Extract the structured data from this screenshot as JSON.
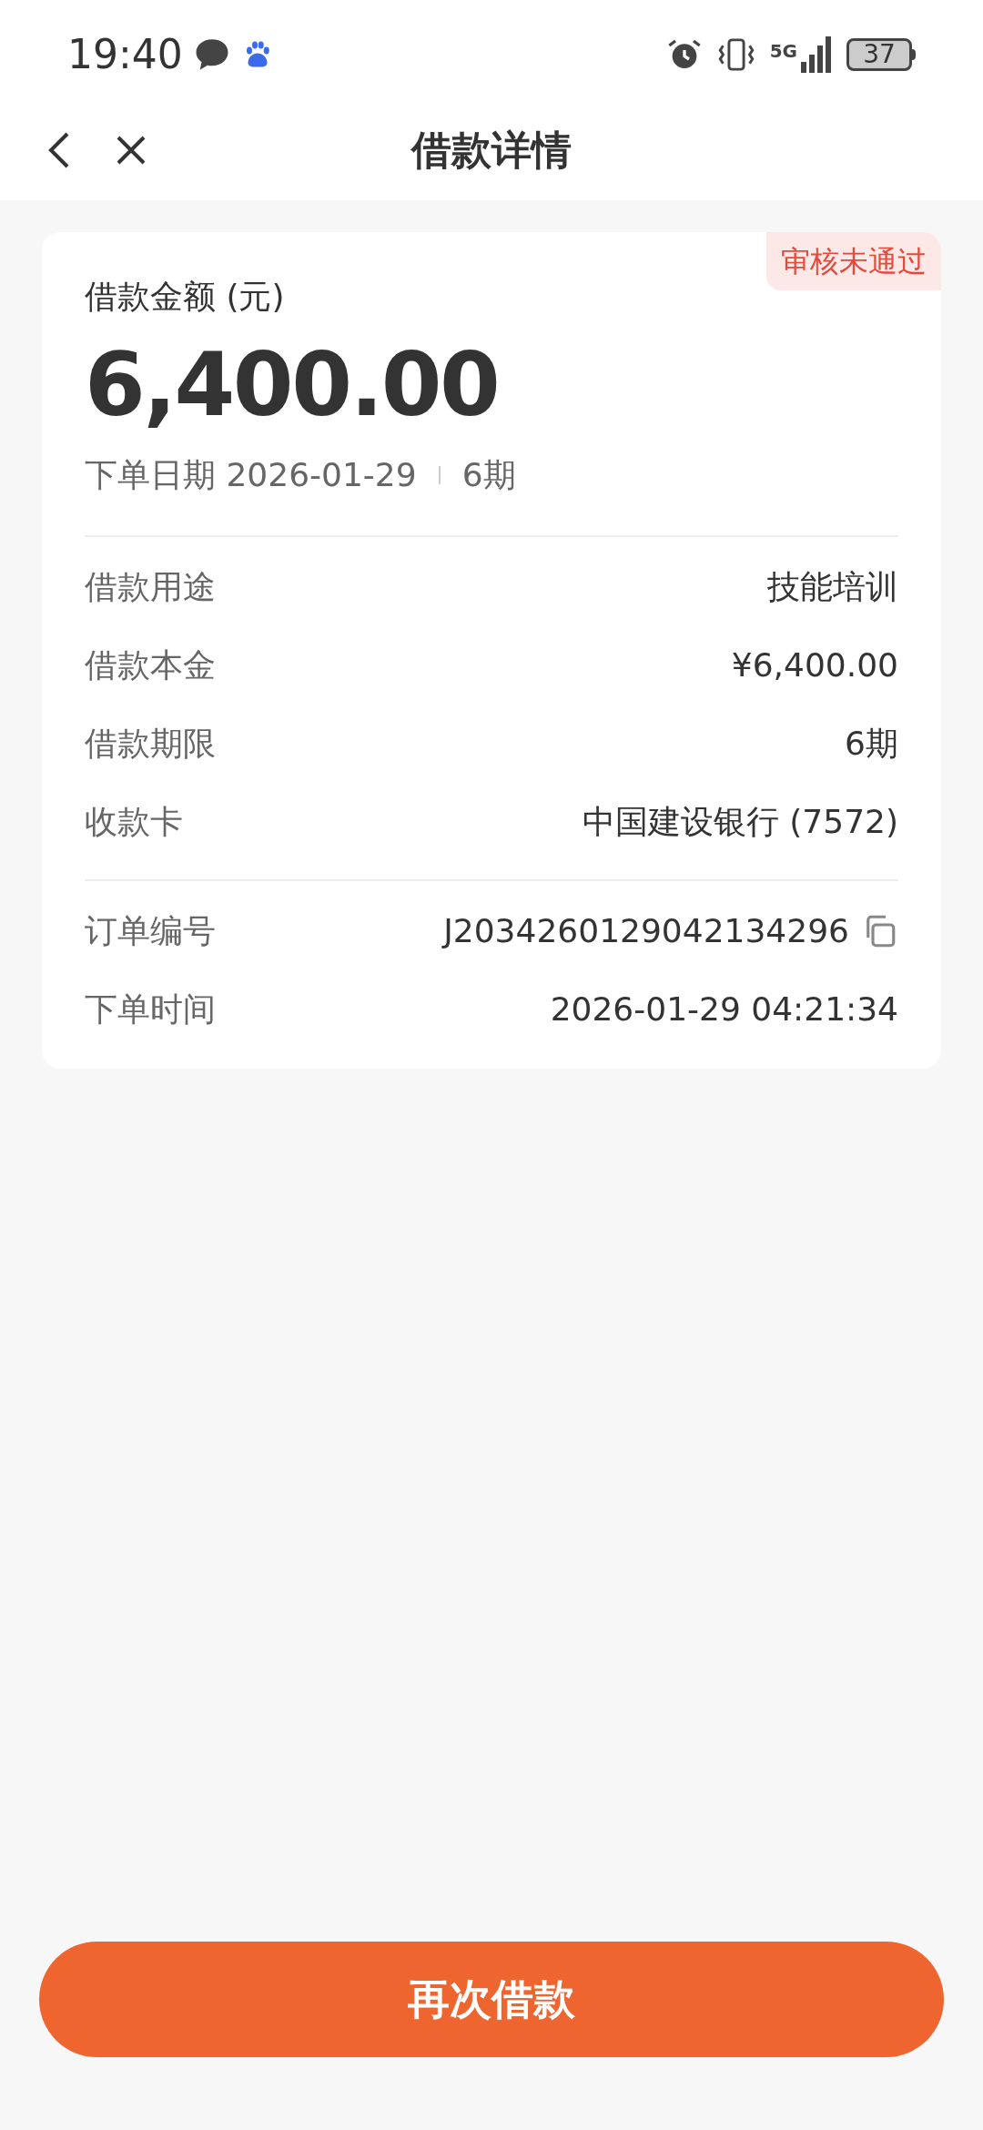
{
  "status_bar": {
    "time": "19:40",
    "battery": "37",
    "network": "5G"
  },
  "header": {
    "title": "借款详情"
  },
  "card": {
    "status_badge": "审核未通过",
    "amount_label": "借款金额 (元)",
    "amount": "6,400.00",
    "order_date": "下单日期 2026-01-29",
    "term": "6期",
    "details": [
      {
        "label": "借款用途",
        "value": "技能培训"
      },
      {
        "label": "借款本金",
        "value": "¥6,400.00"
      },
      {
        "label": "借款期限",
        "value": "6期"
      },
      {
        "label": "收款卡",
        "value": "中国建设银行 (7572)"
      }
    ],
    "order_info": [
      {
        "label": "订单编号",
        "value": "J2034260129042134296",
        "kind": "copy"
      },
      {
        "label": "下单时间",
        "value": "2026-01-29 04:21:34",
        "kind": "plain"
      }
    ]
  },
  "button": {
    "label": "再次借款"
  }
}
